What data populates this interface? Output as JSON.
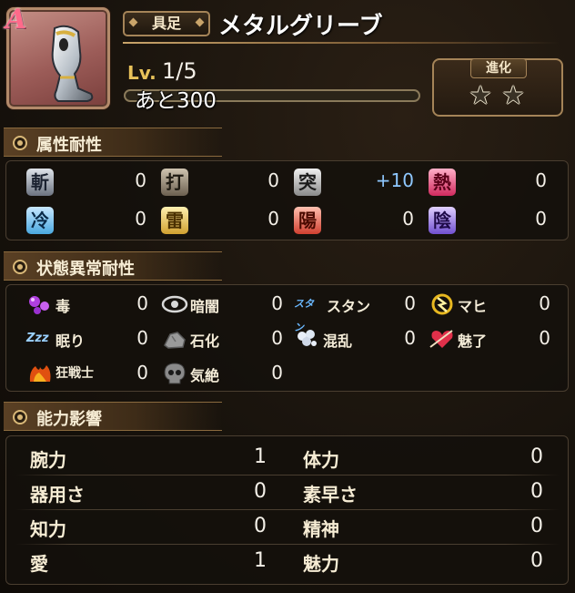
{
  "header": {
    "rank": "A",
    "type_tag": "具足",
    "item_name": "メタルグリーブ",
    "level_label": "Lv.",
    "level_value": "1/5",
    "exp_text": "あと300",
    "exp_progress": 0.0,
    "evolution": {
      "label": "進化",
      "stars_total": 2,
      "stars_filled": 0
    }
  },
  "elemental": {
    "title": "属性耐性",
    "items": [
      {
        "glyph": "斬",
        "name": "slash",
        "value": "0"
      },
      {
        "glyph": "打",
        "name": "strike",
        "value": "0"
      },
      {
        "glyph": "突",
        "name": "pierce",
        "value": "+10"
      },
      {
        "glyph": "熱",
        "name": "heat",
        "value": "0"
      },
      {
        "glyph": "冷",
        "name": "cold",
        "value": "0"
      },
      {
        "glyph": "雷",
        "name": "thunder",
        "value": "0"
      },
      {
        "glyph": "陽",
        "name": "light",
        "value": "0"
      },
      {
        "glyph": "陰",
        "name": "dark",
        "value": "0"
      }
    ]
  },
  "status": {
    "title": "状態異常耐性",
    "items": [
      {
        "label": "毒",
        "icon": "poison-icon",
        "value": "0"
      },
      {
        "label": "暗闇",
        "icon": "blind-eye-icon",
        "value": "0"
      },
      {
        "label": "スタン",
        "icon": "stun-icon",
        "value": "0",
        "icon_text": "スタン"
      },
      {
        "label": "マヒ",
        "icon": "paralysis-icon",
        "value": "0"
      },
      {
        "label": "眠り",
        "icon": "sleep-zzz-icon",
        "value": "0",
        "icon_text": "Zzz"
      },
      {
        "label": "石化",
        "icon": "stone-icon",
        "value": "0"
      },
      {
        "label": "混乱",
        "icon": "confusion-icon",
        "value": "0"
      },
      {
        "label": "魅了",
        "icon": "charm-heart-icon",
        "value": "0"
      },
      {
        "label": "狂戦士",
        "icon": "berserk-icon",
        "value": "0"
      },
      {
        "label": "気絶",
        "icon": "faint-skull-icon",
        "value": "0"
      }
    ]
  },
  "abilities": {
    "title": "能力影響",
    "rows": [
      {
        "left_label": "腕力",
        "left_value": "1",
        "right_label": "体力",
        "right_value": "0"
      },
      {
        "left_label": "器用さ",
        "left_value": "0",
        "right_label": "素早さ",
        "right_value": "0"
      },
      {
        "left_label": "知力",
        "left_value": "0",
        "right_label": "精神",
        "right_value": "0"
      },
      {
        "left_label": "愛",
        "left_value": "1",
        "right_label": "魅力",
        "right_value": "0"
      }
    ]
  },
  "colors": {
    "gold_accent": "#c9a46a",
    "positive_value": "#8fc8ff",
    "panel_bg": "#14100c"
  }
}
